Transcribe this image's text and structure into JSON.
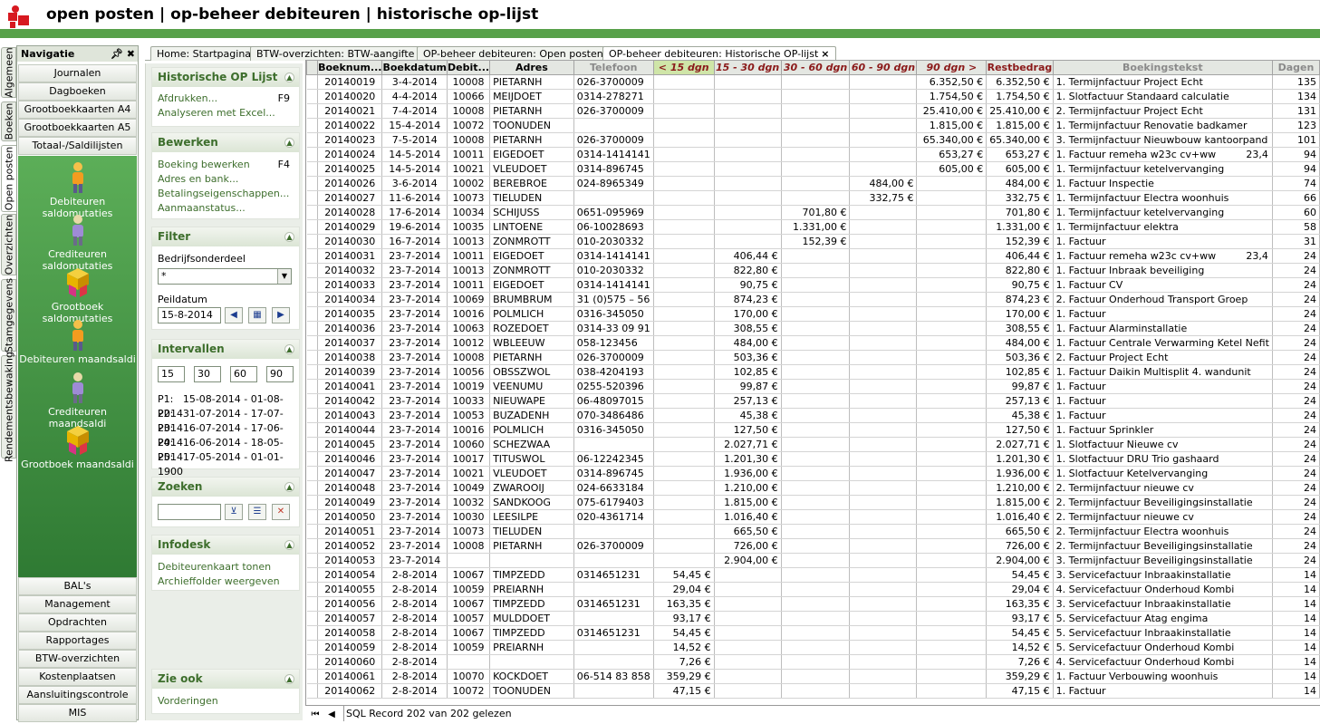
{
  "title": "open posten  |  op-beheer debiteuren  |  historische op-lijst",
  "navigation": {
    "header": "Navigatie",
    "pin": "Ĺ",
    "close": "✖",
    "top_items": [
      "Journalen",
      "Dagboeken",
      "Grootboekkaarten A4",
      "Grootboekkaarten A5",
      "Totaal-/Saldilijsten"
    ],
    "icon_items": [
      "Debiteuren saldomutaties",
      "Crediteuren saldomutaties",
      "Grootboek saldomutaties",
      "Debiteuren maandsaldi",
      "Crediteuren maandsaldi",
      "Grootboek maandsaldi"
    ],
    "bottom_items": [
      "BAL's",
      "Management",
      "Opdrachten",
      "Rapportages",
      "BTW-overzichten",
      "Kostenplaatsen",
      "Aansluitingscontrole",
      "MIS"
    ]
  },
  "vertical_tabs": [
    "Algemeen",
    "Boeken",
    "Open posten",
    "Overzichten",
    "Stamgegevens",
    "Rendementsbewaking"
  ],
  "doc_tabs": [
    "Home: Startpagina",
    "BTW-overzichten: BTW-aangifte",
    "OP-beheer debiteuren: Open posten",
    "OP-beheer debiteuren: Historische OP-lijst"
  ],
  "panel": {
    "historische": {
      "title": "Historische OP Lijst",
      "items": [
        {
          "label": "Afdrukken...",
          "key": "F9"
        },
        {
          "label": "Analyseren met Excel...",
          "key": ""
        }
      ]
    },
    "bewerken": {
      "title": "Bewerken",
      "items": [
        {
          "label": "Boeking bewerken",
          "key": "F4"
        },
        {
          "label": "Adres en bank...",
          "key": ""
        },
        {
          "label": "Betalingseigenschappen...",
          "key": ""
        },
        {
          "label": "Aanmaanstatus...",
          "key": ""
        }
      ]
    },
    "filter": {
      "title": "Filter",
      "bedrijf_label": "Bedrijfsonderdeel",
      "bedrijf_value": "*",
      "peildatum_label": "Peildatum",
      "peildatum_value": "15-8-2014"
    },
    "intervallen": {
      "title": "Intervallen",
      "values": [
        "15",
        "30",
        "60",
        "90"
      ],
      "periods": [
        {
          "p": "P1:",
          "range": "15-08-2014 - 01-08-2014"
        },
        {
          "p": "P2:",
          "range": "31-07-2014 - 17-07-2014"
        },
        {
          "p": "P3:",
          "range": "16-07-2014 - 17-06-2014"
        },
        {
          "p": "P4:",
          "range": "16-06-2014 - 18-05-2014"
        },
        {
          "p": "P5:",
          "range": "17-05-2014 - 01-01-1900"
        }
      ]
    },
    "zoeken": {
      "title": "Zoeken",
      "value": ""
    },
    "infodesk": {
      "title": "Infodesk",
      "items": [
        "Debiteurenkaart tonen",
        "Archieffolder weergeven"
      ]
    },
    "zieook": {
      "title": "Zie ook",
      "items": [
        "Vorderingen"
      ]
    }
  },
  "grid": {
    "columns": [
      "Boeknum...",
      "Boekdatum",
      "Debit...",
      "Adres",
      "Telefoon",
      "< 15 dgn",
      "15 - 30 dgn",
      "30 - 60 dgn",
      "60 - 90 dgn",
      "90 dgn >",
      "Restbedrag",
      "Boekingstekst",
      "Dagen"
    ],
    "rows": [
      [
        "20140019",
        "3-4-2014",
        "10008",
        "PIETARNH",
        "026-3700009",
        "",
        "",
        "",
        "",
        "6.352,50 €",
        "6.352,50 €",
        "1. Termijnfactuur Project Echt",
        "",
        "135"
      ],
      [
        "20140020",
        "4-4-2014",
        "10066",
        "MEIJDOET",
        "0314-278271",
        "",
        "",
        "",
        "",
        "1.754,50 €",
        "1.754,50 €",
        "1. Slotfactuur Standaard calculatie",
        "",
        "134"
      ],
      [
        "20140021",
        "7-4-2014",
        "10008",
        "PIETARNH",
        "026-3700009",
        "",
        "",
        "",
        "",
        "25.410,00 €",
        "25.410,00 €",
        "2. Termijnfactuur Project Echt",
        "",
        "131"
      ],
      [
        "20140022",
        "15-4-2014",
        "10072",
        "TOONUDEN",
        "",
        "",
        "",
        "",
        "",
        "1.815,00 €",
        "1.815,00 €",
        "1. Termijnfactuur Renovatie badkamer",
        "",
        "123"
      ],
      [
        "20140023",
        "7-5-2014",
        "10008",
        "PIETARNH",
        "026-3700009",
        "",
        "",
        "",
        "",
        "65.340,00 €",
        "65.340,00 €",
        "3. Termijnfactuur Nieuwbouw kantoorpand",
        "",
        "101"
      ],
      [
        "20140024",
        "14-5-2014",
        "10011",
        "EIGEDOET",
        "0314-1414141",
        "",
        "",
        "",
        "",
        "653,27 €",
        "653,27 €",
        "1. Factuur remeha w23c cv+ww",
        "23,4",
        "94"
      ],
      [
        "20140025",
        "14-5-2014",
        "10021",
        "VLEUDOET",
        "0314-896745",
        "",
        "",
        "",
        "",
        "605,00 €",
        "605,00 €",
        "1. Termijnfactuur ketelvervanging",
        "",
        "94"
      ],
      [
        "20140026",
        "3-6-2014",
        "10002",
        "BEREBROE",
        "024-8965349",
        "",
        "",
        "",
        "484,00 €",
        "",
        "484,00 €",
        "1. Factuur Inspectie",
        "",
        "74"
      ],
      [
        "20140027",
        "11-6-2014",
        "10073",
        "TIELUDEN",
        "",
        "",
        "",
        "",
        "332,75 €",
        "",
        "332,75 €",
        "1. Termijnfactuur Electra woonhuis",
        "",
        "66"
      ],
      [
        "20140028",
        "17-6-2014",
        "10034",
        "SCHIJUSS",
        "0651-095969",
        "",
        "",
        "701,80 €",
        "",
        "",
        "701,80 €",
        "1. Termijnfactuur  ketelvervanging",
        "",
        "60"
      ],
      [
        "20140029",
        "19-6-2014",
        "10035",
        "LINTOENE",
        "06-10028693",
        "",
        "",
        "1.331,00 €",
        "",
        "",
        "1.331,00 €",
        "1. Termijnfactuur elektra",
        "",
        "58"
      ],
      [
        "20140030",
        "16-7-2014",
        "10013",
        "ZONMROTT",
        "010-2030332",
        "",
        "",
        "152,39 €",
        "",
        "",
        "152,39 €",
        "1. Factuur",
        "",
        "31"
      ],
      [
        "20140031",
        "23-7-2014",
        "10011",
        "EIGEDOET",
        "0314-1414141",
        "",
        "406,44 €",
        "",
        "",
        "",
        "406,44 €",
        "1. Factuur remeha w23c cv+ww",
        "23,4",
        "24"
      ],
      [
        "20140032",
        "23-7-2014",
        "10013",
        "ZONMROTT",
        "010-2030332",
        "",
        "822,80 €",
        "",
        "",
        "",
        "822,80 €",
        "1. Factuur Inbraak beveiliging",
        "",
        "24"
      ],
      [
        "20140033",
        "23-7-2014",
        "10011",
        "EIGEDOET",
        "0314-1414141",
        "",
        "90,75 €",
        "",
        "",
        "",
        "90,75 €",
        "1. Factuur CV",
        "",
        "24"
      ],
      [
        "20140034",
        "23-7-2014",
        "10069",
        "BRUMBRUM",
        "31 (0)575 – 56",
        "",
        "874,23 €",
        "",
        "",
        "",
        "874,23 €",
        "2. Factuur Onderhoud Transport Groep",
        "",
        "24"
      ],
      [
        "20140035",
        "23-7-2014",
        "10016",
        "POLMLICH",
        "0316-345050",
        "",
        "170,00 €",
        "",
        "",
        "",
        "170,00 €",
        "1. Factuur",
        "",
        "24"
      ],
      [
        "20140036",
        "23-7-2014",
        "10063",
        "ROZEDOET",
        "0314-33 09 91",
        "",
        "308,55 €",
        "",
        "",
        "",
        "308,55 €",
        "1. Factuur Alarminstallatie",
        "",
        "24"
      ],
      [
        "20140037",
        "23-7-2014",
        "10012",
        "WBLEEUW",
        "058-123456",
        "",
        "484,00 €",
        "",
        "",
        "",
        "484,00 €",
        "1. Factuur Centrale Verwarming Ketel Nefit",
        "",
        "24"
      ],
      [
        "20140038",
        "23-7-2014",
        "10008",
        "PIETARNH",
        "026-3700009",
        "",
        "503,36 €",
        "",
        "",
        "",
        "503,36 €",
        "2. Factuur Project Echt",
        "",
        "24"
      ],
      [
        "20140039",
        "23-7-2014",
        "10056",
        "OBSSZWOL",
        "038-4204193",
        "",
        "102,85 €",
        "",
        "",
        "",
        "102,85 €",
        "1. Factuur Daikin Multisplit 4. wandunit",
        "",
        "24"
      ],
      [
        "20140041",
        "23-7-2014",
        "10019",
        "VEENUMU",
        "0255-520396",
        "",
        "99,87 €",
        "",
        "",
        "",
        "99,87 €",
        "1. Factuur",
        "",
        "24"
      ],
      [
        "20140042",
        "23-7-2014",
        "10033",
        "NIEUWAPE",
        "06-48097015",
        "",
        "257,13 €",
        "",
        "",
        "",
        "257,13 €",
        "1. Factuur",
        "",
        "24"
      ],
      [
        "20140043",
        "23-7-2014",
        "10053",
        "BUZADENH",
        "070-3486486",
        "",
        "45,38 €",
        "",
        "",
        "",
        "45,38 €",
        "1. Factuur",
        "",
        "24"
      ],
      [
        "20140044",
        "23-7-2014",
        "10016",
        "POLMLICH",
        "0316-345050",
        "",
        "127,50 €",
        "",
        "",
        "",
        "127,50 €",
        "1. Factuur Sprinkler",
        "",
        "24"
      ],
      [
        "20140045",
        "23-7-2014",
        "10060",
        "SCHEZWAA",
        "",
        "",
        "2.027,71 €",
        "",
        "",
        "",
        "2.027,71 €",
        "1. Slotfactuur Nieuwe cv",
        "",
        "24"
      ],
      [
        "20140046",
        "23-7-2014",
        "10017",
        "TITUSWOL",
        "06-12242345",
        "",
        "1.201,30 €",
        "",
        "",
        "",
        "1.201,30 €",
        "1. Slotfactuur DRU Trio gashaard",
        "",
        "24"
      ],
      [
        "20140047",
        "23-7-2014",
        "10021",
        "VLEUDOET",
        "0314-896745",
        "",
        "1.936,00 €",
        "",
        "",
        "",
        "1.936,00 €",
        "1. Slotfactuur Ketelvervanging",
        "",
        "24"
      ],
      [
        "20140048",
        "23-7-2014",
        "10049",
        "ZWAROOIJ",
        "024-6633184",
        "",
        "1.210,00 €",
        "",
        "",
        "",
        "1.210,00 €",
        "2. Termijnfactuur nieuwe cv",
        "",
        "24"
      ],
      [
        "20140049",
        "23-7-2014",
        "10032",
        "SANDKOOG",
        "075-6179403",
        "",
        "1.815,00 €",
        "",
        "",
        "",
        "1.815,00 €",
        "2. Termijnfactuur Beveiligingsinstallatie",
        "",
        "24"
      ],
      [
        "20140050",
        "23-7-2014",
        "10030",
        "LEESILPE",
        "020-4361714",
        "",
        "1.016,40 €",
        "",
        "",
        "",
        "1.016,40 €",
        "2. Termijnfactuur nieuwe cv",
        "",
        "24"
      ],
      [
        "20140051",
        "23-7-2014",
        "10073",
        "TIELUDEN",
        "",
        "",
        "665,50 €",
        "",
        "",
        "",
        "665,50 €",
        "2. Termijnfactuur Electra woonhuis",
        "",
        "24"
      ],
      [
        "20140052",
        "23-7-2014",
        "10008",
        "PIETARNH",
        "026-3700009",
        "",
        "726,00 €",
        "",
        "",
        "",
        "726,00 €",
        "2. Termijnfactuur Beveiligingsinstallatie",
        "",
        "24"
      ],
      [
        "20140053",
        "23-7-2014",
        "",
        "",
        "",
        "",
        "2.904,00 €",
        "",
        "",
        "",
        "2.904,00 €",
        "3. Termijnfactuur Beveiligingsinstallatie",
        "",
        "24"
      ],
      [
        "20140054",
        "2-8-2014",
        "10067",
        "TIMPZEDD",
        "0314651231",
        "54,45 €",
        "",
        "",
        "",
        "",
        "54,45 €",
        "3. Servicefactuur Inbraakinstallatie",
        "",
        "14"
      ],
      [
        "20140055",
        "2-8-2014",
        "10059",
        "PREIARNH",
        "",
        "29,04 €",
        "",
        "",
        "",
        "",
        "29,04 €",
        "4. Servicefactuur Onderhoud Kombi",
        "",
        "14"
      ],
      [
        "20140056",
        "2-8-2014",
        "10067",
        "TIMPZEDD",
        "0314651231",
        "163,35 €",
        "",
        "",
        "",
        "",
        "163,35 €",
        "3. Servicefactuur Inbraakinstallatie",
        "",
        "14"
      ],
      [
        "20140057",
        "2-8-2014",
        "10057",
        "MULDDOET",
        "",
        "93,17 €",
        "",
        "",
        "",
        "",
        "93,17 €",
        "5. Servicefactuur Atag engima",
        "",
        "14"
      ],
      [
        "20140058",
        "2-8-2014",
        "10067",
        "TIMPZEDD",
        "0314651231",
        "54,45 €",
        "",
        "",
        "",
        "",
        "54,45 €",
        "5. Servicefactuur Inbraakinstallatie",
        "",
        "14"
      ],
      [
        "20140059",
        "2-8-2014",
        "10059",
        "PREIARNH",
        "",
        "14,52 €",
        "",
        "",
        "",
        "",
        "14,52 €",
        "5. Servicefactuur Onderhoud Kombi",
        "",
        "14"
      ],
      [
        "20140060",
        "2-8-2014",
        "",
        "",
        "",
        "7,26 €",
        "",
        "",
        "",
        "",
        "7,26 €",
        "4. Servicefactuur Onderhoud Kombi",
        "",
        "14"
      ],
      [
        "20140061",
        "2-8-2014",
        "10070",
        "KOCKDOET",
        "06-514 83 858",
        "359,29 €",
        "",
        "",
        "",
        "",
        "359,29 €",
        "1. Factuur Verbouwing woonhuis",
        "",
        "14"
      ],
      [
        "20140062",
        "2-8-2014",
        "10072",
        "TOONUDEN",
        "",
        "47,15 €",
        "",
        "",
        "",
        "",
        "47,15 €",
        "1. Factuur",
        "",
        "14"
      ]
    ]
  },
  "status": {
    "text": "SQL Record 202 van 202 gelezen"
  }
}
